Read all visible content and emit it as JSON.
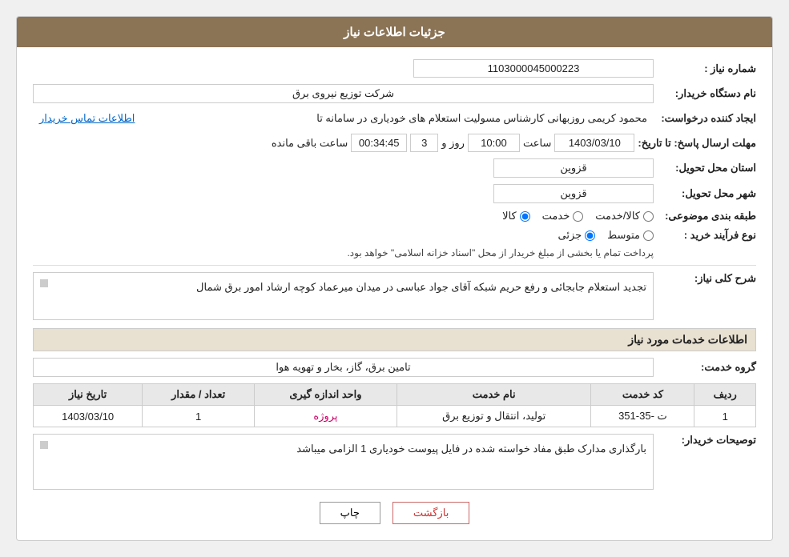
{
  "header": {
    "title": "جزئیات اطلاعات نیاز"
  },
  "fields": {
    "shomara_niaz_label": "شماره نیاز :",
    "shomara_niaz_value": "1103000045000223",
    "nam_dastgah_label": "نام دستگاه خریدار:",
    "nam_dastgah_value": "شرکت توزیع نیروی برق",
    "ijad_konande_label": "ایجاد کننده درخواست:",
    "ijad_konande_value": "محمود کریمی روزبهانی کارشناس  مسولیت استعلام های خودیاری در سامانه تا",
    "ettelaat_link": "اطلاعات تماس خریدار",
    "mohlat_label": "مهلت ارسال پاسخ: تا تاریخ:",
    "mohlat_date": "1403/03/10",
    "mohlat_saat_label": "ساعت",
    "mohlat_saat": "10:00",
    "mohlat_rooz_label": "روز و",
    "mohlat_rooz": "3",
    "mohlat_baqi_label": "ساعت باقی مانده",
    "mohlat_baqi": "00:34:45",
    "ostan_label": "استان محل تحویل:",
    "ostan_value": "قزوین",
    "shahr_label": "شهر محل تحویل:",
    "shahr_value": "قزوین",
    "tabaqe_label": "طبقه بندی موضوعی:",
    "tabaqe_kala": "کالا",
    "tabaqe_khadamat": "خدمت",
    "tabaqe_kala_khadamat": "کالا/خدمت",
    "tabaqe_selected": "kala",
    "navoe_farayand_label": "نوع فرآیند خرید :",
    "navoe_jozii": "جزئی",
    "navoe_mootasset": "متوسط",
    "navoe_note": "پرداخت تمام یا بخشی از مبلغ خریدار از محل \"اسناد خزانه اسلامی\" خواهد بود.",
    "navoe_selected": "jozii",
    "sharh_label": "شرح کلی نیاز:",
    "sharh_value": "تجدید استعلام جابجائی و رفع حریم شبکه آقای جواد عباسی در میدان میرعماد کوچه ارشاد امور برق شمال",
    "service_section_label": "اطلاعات خدمات مورد نیاز",
    "group_label": "گروه خدمت:",
    "group_value": "تامین برق، گاز، بخار و تهویه هوا",
    "table_headers": [
      "ردیف",
      "کد خدمت",
      "نام خدمت",
      "واحد اندازه گیری",
      "تعداد / مقدار",
      "تاریخ نیاز"
    ],
    "table_rows": [
      {
        "radif": "1",
        "code": "ت -35-351",
        "name": "تولید، انتقال و توزیع برق",
        "unit": "پروژه",
        "tedad": "1",
        "date": "1403/03/10"
      }
    ],
    "tosih_label": "توصیحات خریدار:",
    "tosih_value": "بارگذاری مدارک طبق مفاد خواسته شده در فایل پیوست خودیاری 1 الزامی میباشد"
  },
  "buttons": {
    "chap": "چاپ",
    "bazgasht": "بازگشت"
  }
}
